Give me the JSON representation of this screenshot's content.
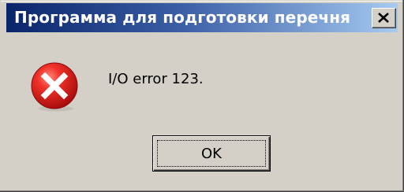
{
  "dialog": {
    "title": "Программа для подготовки перечня",
    "message": "I/O error 123.",
    "icon": "error-icon",
    "ok_label": "OK",
    "close_icon": "close-icon"
  },
  "colors": {
    "titlebar_start": "#0a246a",
    "titlebar_end": "#a6caf0",
    "window_face": "#d4d0c8",
    "error_red": "#e0201a"
  }
}
